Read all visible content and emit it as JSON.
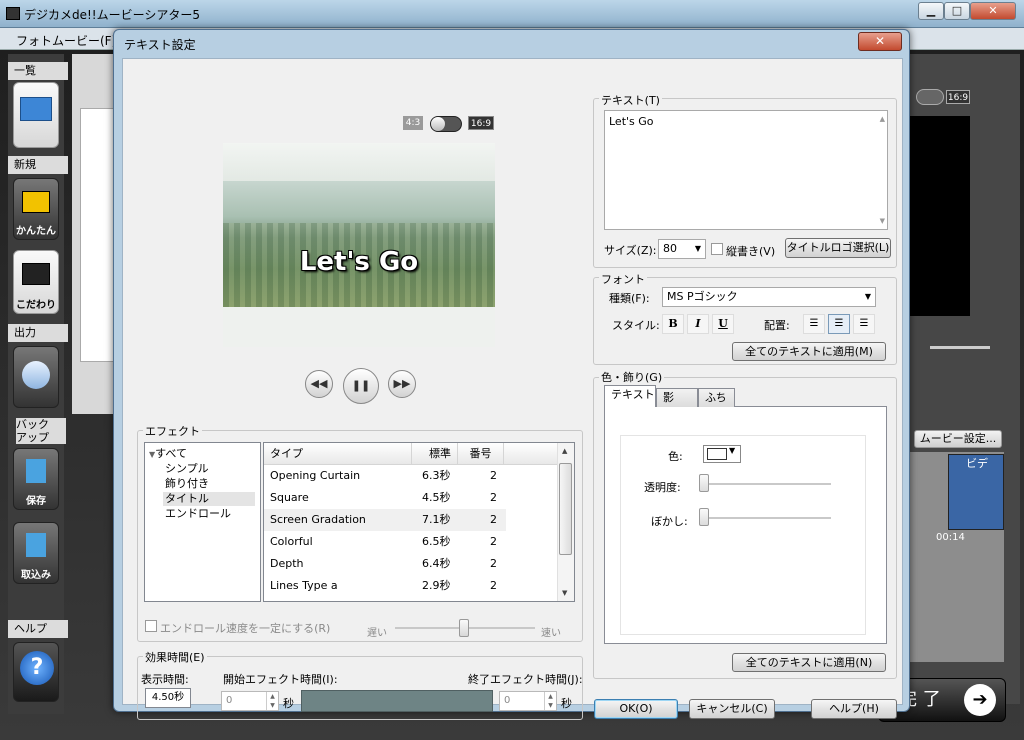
{
  "main": {
    "title": "デジカメde!!ムービーシアター5",
    "menu_photomovie": "フォトムービー(F)",
    "min_glyph": "▁",
    "max_glyph": "□",
    "close_glyph": "✕",
    "left_toolbar": {
      "list_label": "一覧",
      "new_label": "新規",
      "easy_label": "かんたん",
      "detail_label": "こだわり",
      "output_label": "出力",
      "backup_label": "バック\nアップ",
      "save_label": "保存",
      "import_label": "取込み",
      "help_label": "ヘルプ"
    },
    "aspect_169": "16:9",
    "movie_setting_label": "ムービー設定...",
    "clip_label": "ビデ",
    "clip_time": "00:14",
    "finish_label": "完 了"
  },
  "dialog": {
    "title": "テキスト設定",
    "close_glyph": "✕",
    "preview": {
      "aspect_43": "4:3",
      "aspect_169": "16:9",
      "overlay_text": "Let's Go"
    },
    "effect": {
      "label": "エフェクト",
      "tree": [
        "すべて",
        "シンプル",
        "飾り付き",
        "タイトル",
        "エンドロール"
      ],
      "tree_selected": "タイトル",
      "columns": [
        "タイプ",
        "標準",
        "番号"
      ],
      "rows": [
        {
          "type": "Opening Curtain",
          "std": "6.3秒",
          "num": "2"
        },
        {
          "type": "Square",
          "std": "4.5秒",
          "num": "2"
        },
        {
          "type": "Screen Gradation",
          "std": "7.1秒",
          "num": "2"
        },
        {
          "type": "Colorful",
          "std": "6.5秒",
          "num": "2"
        },
        {
          "type": "Depth",
          "std": "6.4秒",
          "num": "2"
        },
        {
          "type": "Lines Type a",
          "std": "2.9秒",
          "num": "2"
        }
      ],
      "selected_row": "Screen Gradation",
      "endroll_checkbox_label": "エンドロール速度を一定にする(R)",
      "speed_slow": "遅い",
      "speed_fast": "速い"
    },
    "effect_time": {
      "label": "効果時間(E)",
      "display_time_label": "表示時間:",
      "display_time_value": "4.50秒",
      "start_label": "開始エフェクト時間(I):",
      "start_value": "0",
      "end_label": "終了エフェクト時間(J):",
      "end_value": "0",
      "sec_unit": "秒"
    },
    "text_section": {
      "label": "テキスト(T)",
      "value": "Let's Go",
      "size_label": "サイズ(Z):",
      "size_value": "80",
      "vertical_label": "縦書き(V)",
      "title_logo_button": "タイトルロゴ選択(L)"
    },
    "font_section": {
      "label": "フォント",
      "kind_label": "種類(F):",
      "kind_value": "MS Pゴシック",
      "style_label": "スタイル:",
      "bold": "B",
      "italic": "I",
      "underline": "U",
      "align_label": "配置:",
      "apply_button": "全てのテキストに適用(M)"
    },
    "color_section": {
      "label": "色・飾り(G)",
      "tabs": [
        "テキスト",
        "影",
        "ふち"
      ],
      "active_tab": "テキスト",
      "color_label": "色:",
      "color_value": "#ffffff",
      "opacity_label": "透明度:",
      "blur_label": "ぼかし:",
      "opacity_level": 0,
      "blur_level": 0,
      "apply_button": "全てのテキストに適用(N)"
    },
    "buttons": {
      "ok": "OK(O)",
      "cancel": "キャンセル(C)",
      "help": "ヘルプ(H)"
    }
  }
}
